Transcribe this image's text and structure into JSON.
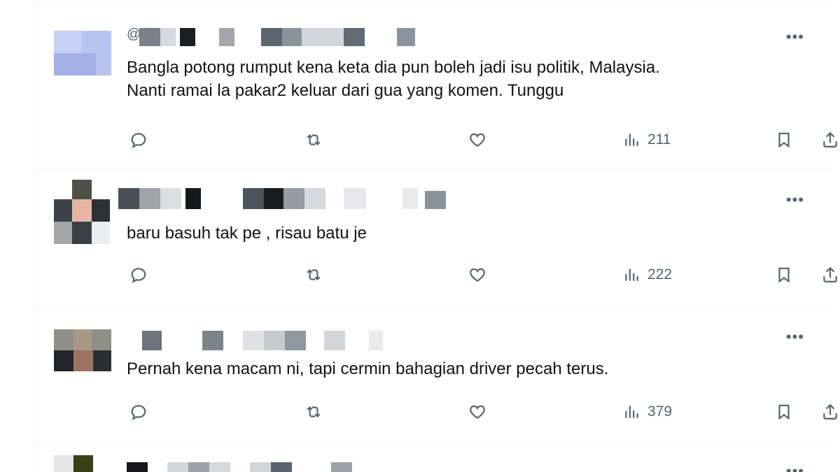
{
  "more_glyph": "•••",
  "at_glyph": "@",
  "icons": {
    "reply": "reply-icon",
    "repost": "repost-icon",
    "like": "like-icon",
    "views": "views-icon",
    "bookmark": "bookmark-icon",
    "share": "share-icon"
  },
  "tweets": [
    {
      "text_line1": "Bangla potong rumput kena keta dia pun boleh jadi isu politik, Malaysia.",
      "text_line2": "Nanti ramai la pakar2 keluar dari gua yang komen. Tunggu",
      "views": "211"
    },
    {
      "text_line1": "baru basuh tak pe , risau batu je",
      "views": "222"
    },
    {
      "text_line1": "Pernah kena macam ni, tapi cermin bahagian driver pecah terus.",
      "views": "379"
    }
  ]
}
